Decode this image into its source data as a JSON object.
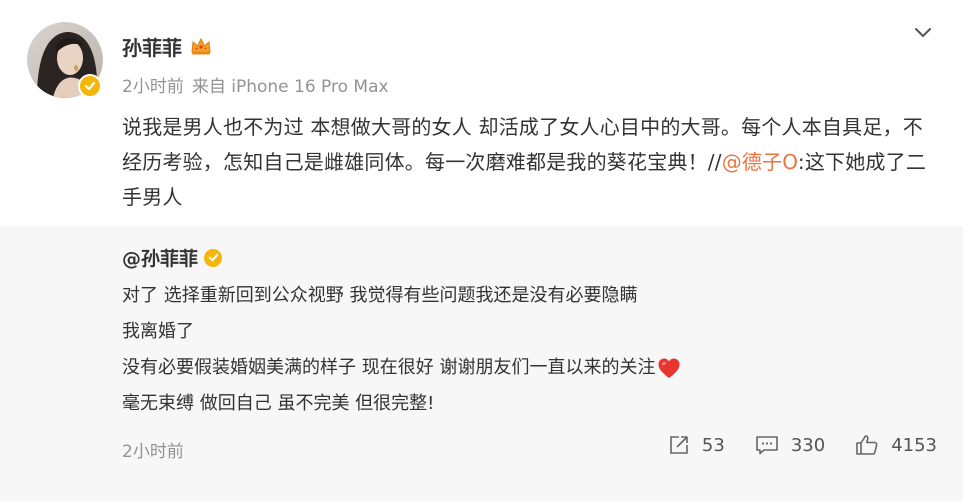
{
  "post": {
    "author": "孙菲菲",
    "time": "2小时前",
    "source": "来自 iPhone 16 Pro Max",
    "text_part1": "说我是男人也不为过 本想做大哥的女人 却活成了女人心目中的大哥。每个人本自具足，不经历考验，怎知自己是雌雄同体。每一次磨难都是我的葵花宝典！//",
    "mention": "@德子O",
    "text_part2": ":这下她成了二手男人"
  },
  "retweet": {
    "author": "@孙菲菲",
    "lines": [
      "对了 选择重新回到公众视野 我觉得有些问题我还是没有必要隐瞒",
      "我离婚了",
      "没有必要假装婚姻美满的样子 现在很好 谢谢朋友们一直以来的关注",
      "毫无束缚 做回自己 虽不完美 但很完整!"
    ],
    "time": "2小时前",
    "repost_count": "53",
    "comment_count": "330",
    "like_count": "4153"
  },
  "icons": {
    "verified": "verified-badge-icon",
    "crown": "crown-icon",
    "menu": "chevron-down-icon",
    "heart": "heart-icon",
    "repost": "repost-icon",
    "comment": "comment-icon",
    "like": "thumbs-up-icon"
  },
  "colors": {
    "mention": "#eb7340",
    "verified": "#f5b60c",
    "retweet_bg": "#f7f7f7",
    "meta": "#939393"
  }
}
